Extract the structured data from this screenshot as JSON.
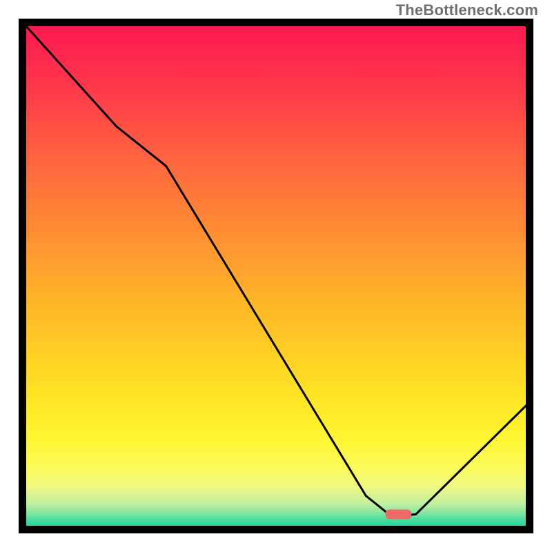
{
  "watermark": "TheBottleneck.com",
  "chart_data": {
    "type": "line",
    "title": "",
    "xlabel": "",
    "ylabel": "",
    "xlim": [
      0,
      100
    ],
    "ylim": [
      0,
      100
    ],
    "series": [
      {
        "name": "curve",
        "x": [
          0,
          18,
          28,
          68,
          73,
          75,
          78,
          100
        ],
        "y": [
          100,
          80,
          72,
          6,
          2,
          2,
          2.3,
          24
        ]
      }
    ],
    "marker": {
      "x_center": 74.5,
      "x_half_width": 2.6,
      "y": 2.3
    },
    "annotations": [],
    "legend": null
  },
  "colors": {
    "curve_stroke": "#000000",
    "marker_fill": "#f06868",
    "gradient_top": "#ff1850",
    "gradient_bottom": "#20d6a0",
    "frame": "#000000"
  }
}
